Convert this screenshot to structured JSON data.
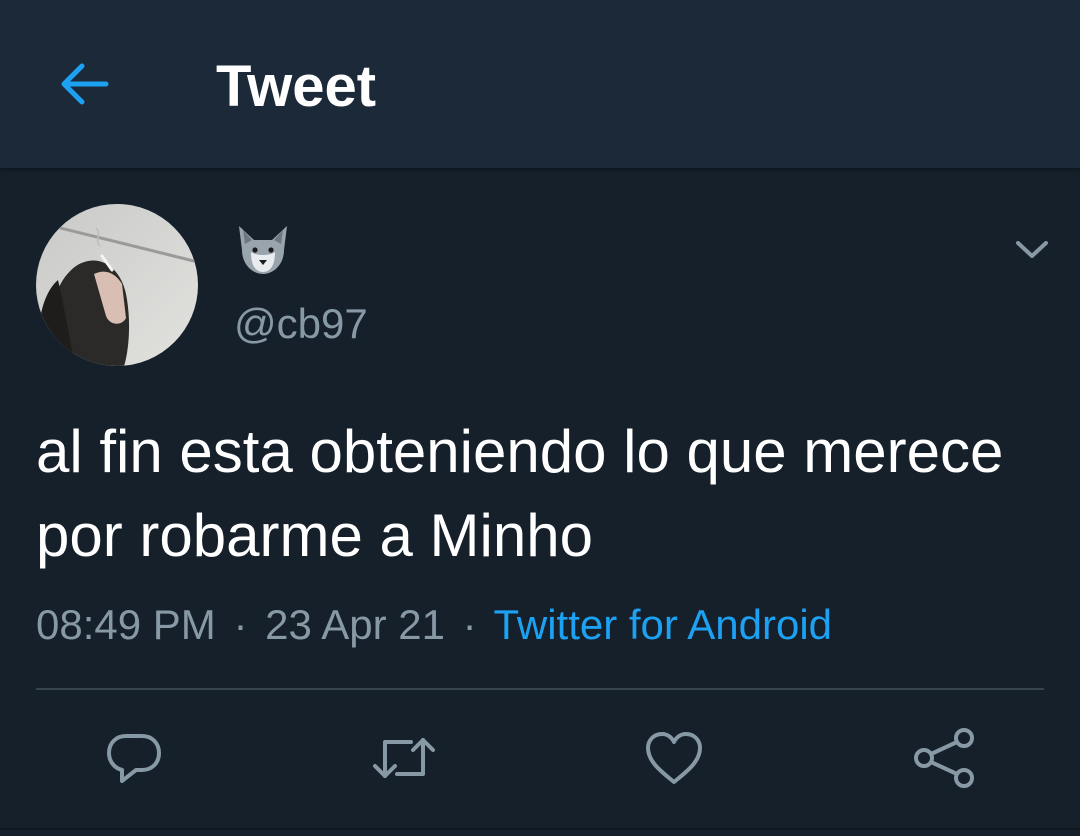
{
  "header": {
    "title": "Tweet",
    "back_icon": "arrow-left-icon"
  },
  "tweet": {
    "avatar_icon": "profile-photo",
    "display_name_icon": "wolf-face-emoji",
    "handle": "@cb97",
    "menu_icon": "chevron-down-icon",
    "text": "al fin esta obteniendo lo que merece por robarme a Minho",
    "time": "08:49 PM",
    "separator": "·",
    "date": "23 Apr 21",
    "source": "Twitter for Android"
  },
  "actions": {
    "reply_icon": "reply-icon",
    "retweet_icon": "retweet-icon",
    "like_icon": "heart-icon",
    "share_icon": "share-icon"
  },
  "colors": {
    "background": "#15202b",
    "header": "#1c2938",
    "accent": "#1da1f2",
    "muted": "#8899a6"
  }
}
